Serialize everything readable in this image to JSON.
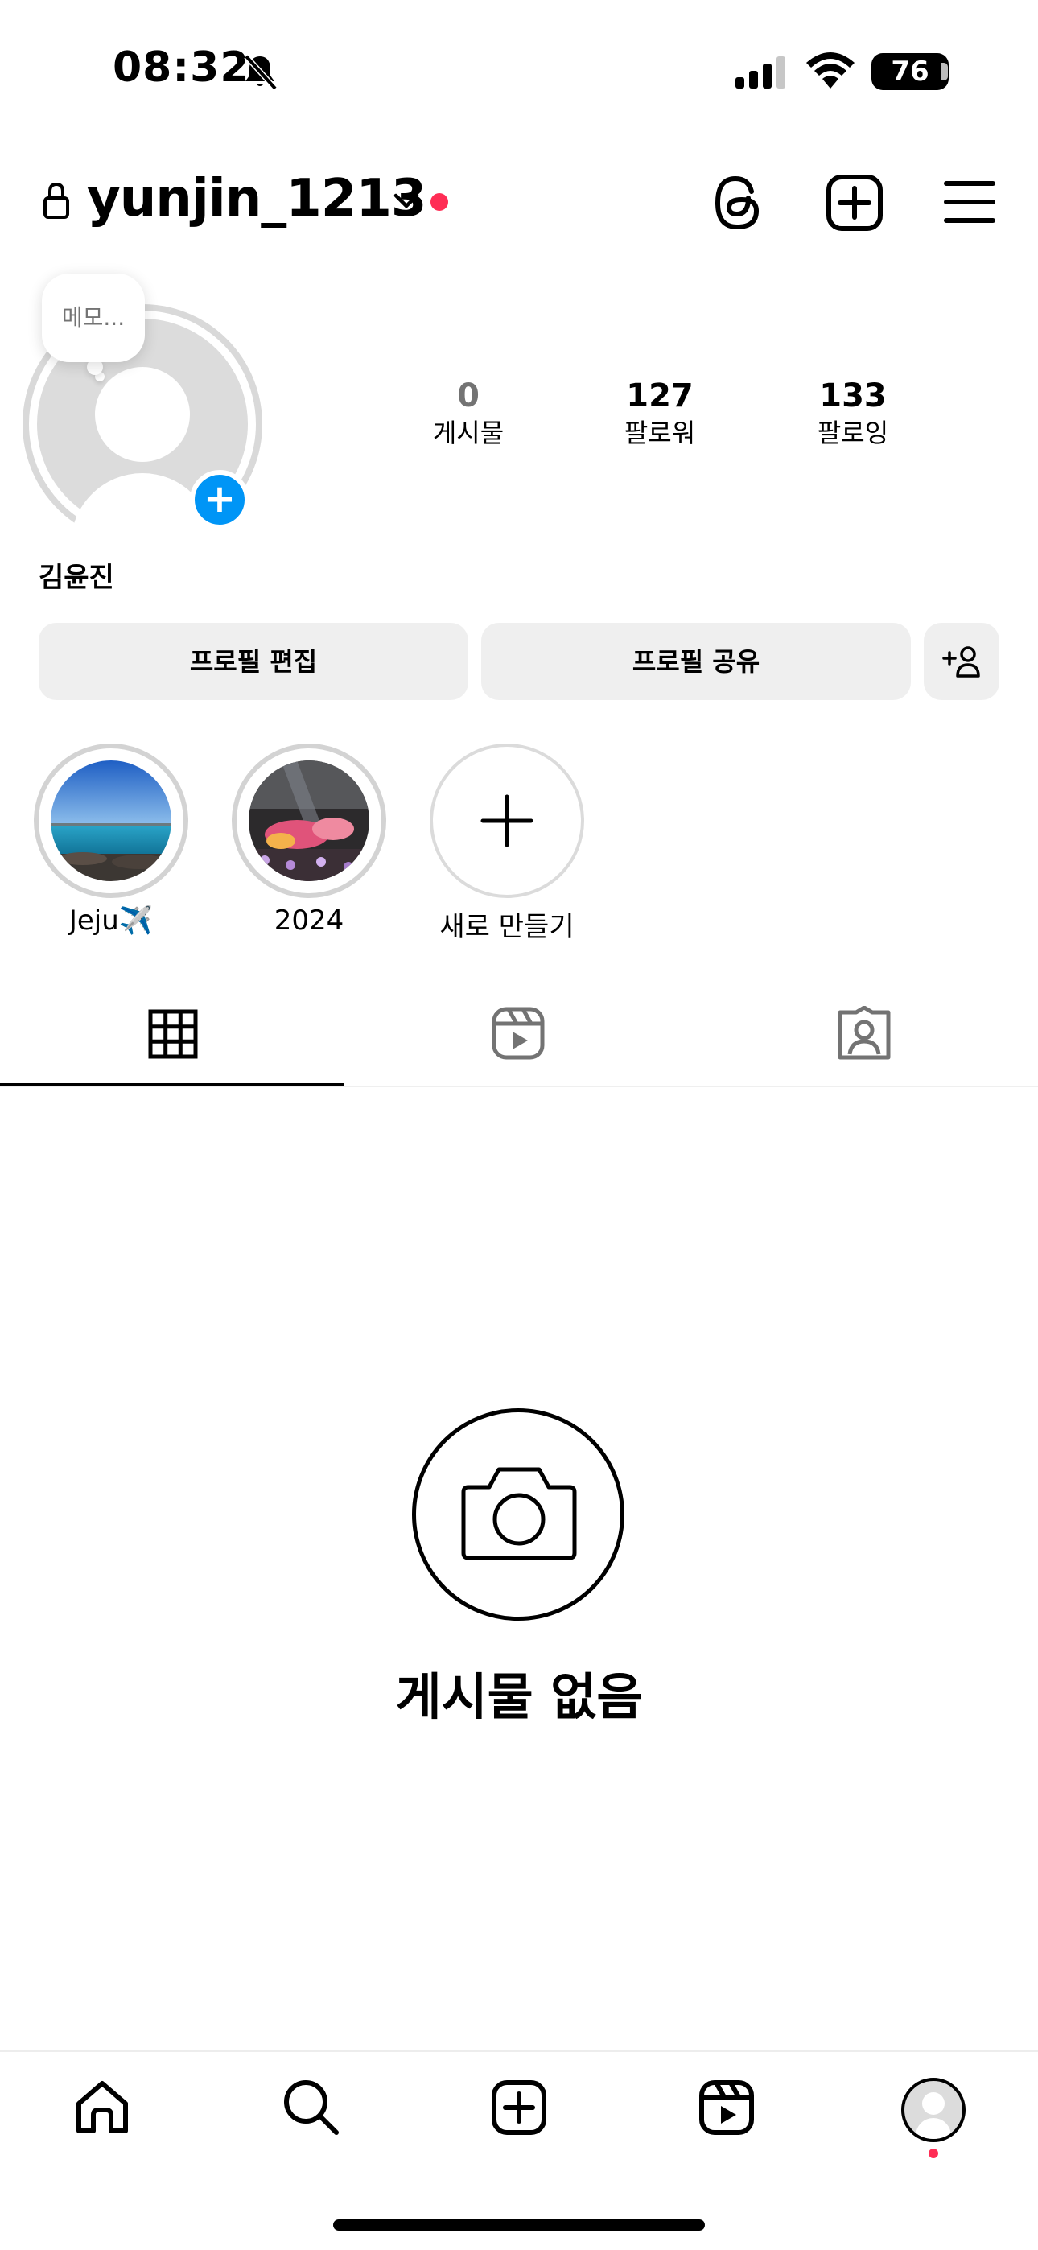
{
  "status_bar": {
    "time": "08:32",
    "battery": "76",
    "icons": [
      "bell-slash-icon",
      "signal-icon",
      "wifi-icon",
      "battery-icon"
    ]
  },
  "header": {
    "username": "yunjin_1213",
    "icons": [
      "lock-icon",
      "chevron-down-icon",
      "threads-icon",
      "new-post-icon",
      "menu-icon"
    ],
    "notification_color": "#ff2d55"
  },
  "profile": {
    "memo": "메모...",
    "display_name": "김윤진",
    "stats": [
      {
        "value": "0",
        "label": "게시물"
      },
      {
        "value": "127",
        "label": "팔로워"
      },
      {
        "value": "133",
        "label": "팔로잉"
      }
    ]
  },
  "actions": {
    "edit_profile": "프로필 편집",
    "share_profile": "프로필 공유",
    "discover_people_icon": "add-person-icon"
  },
  "highlights": [
    {
      "label": "Jeju✈️"
    },
    {
      "label": "2024"
    },
    {
      "label": "새로 만들기"
    }
  ],
  "tabs": [
    "grid-icon",
    "reels-icon",
    "tagged-icon"
  ],
  "empty_state": {
    "title": "게시물 없음",
    "icon": "camera-icon"
  },
  "bottom_nav": [
    "home-icon",
    "search-icon",
    "create-icon",
    "reels-icon",
    "profile-icon"
  ],
  "colors": {
    "accent_blue": "#0095f6",
    "notification_red": "#ff2d55",
    "button_bg": "#efefef"
  }
}
